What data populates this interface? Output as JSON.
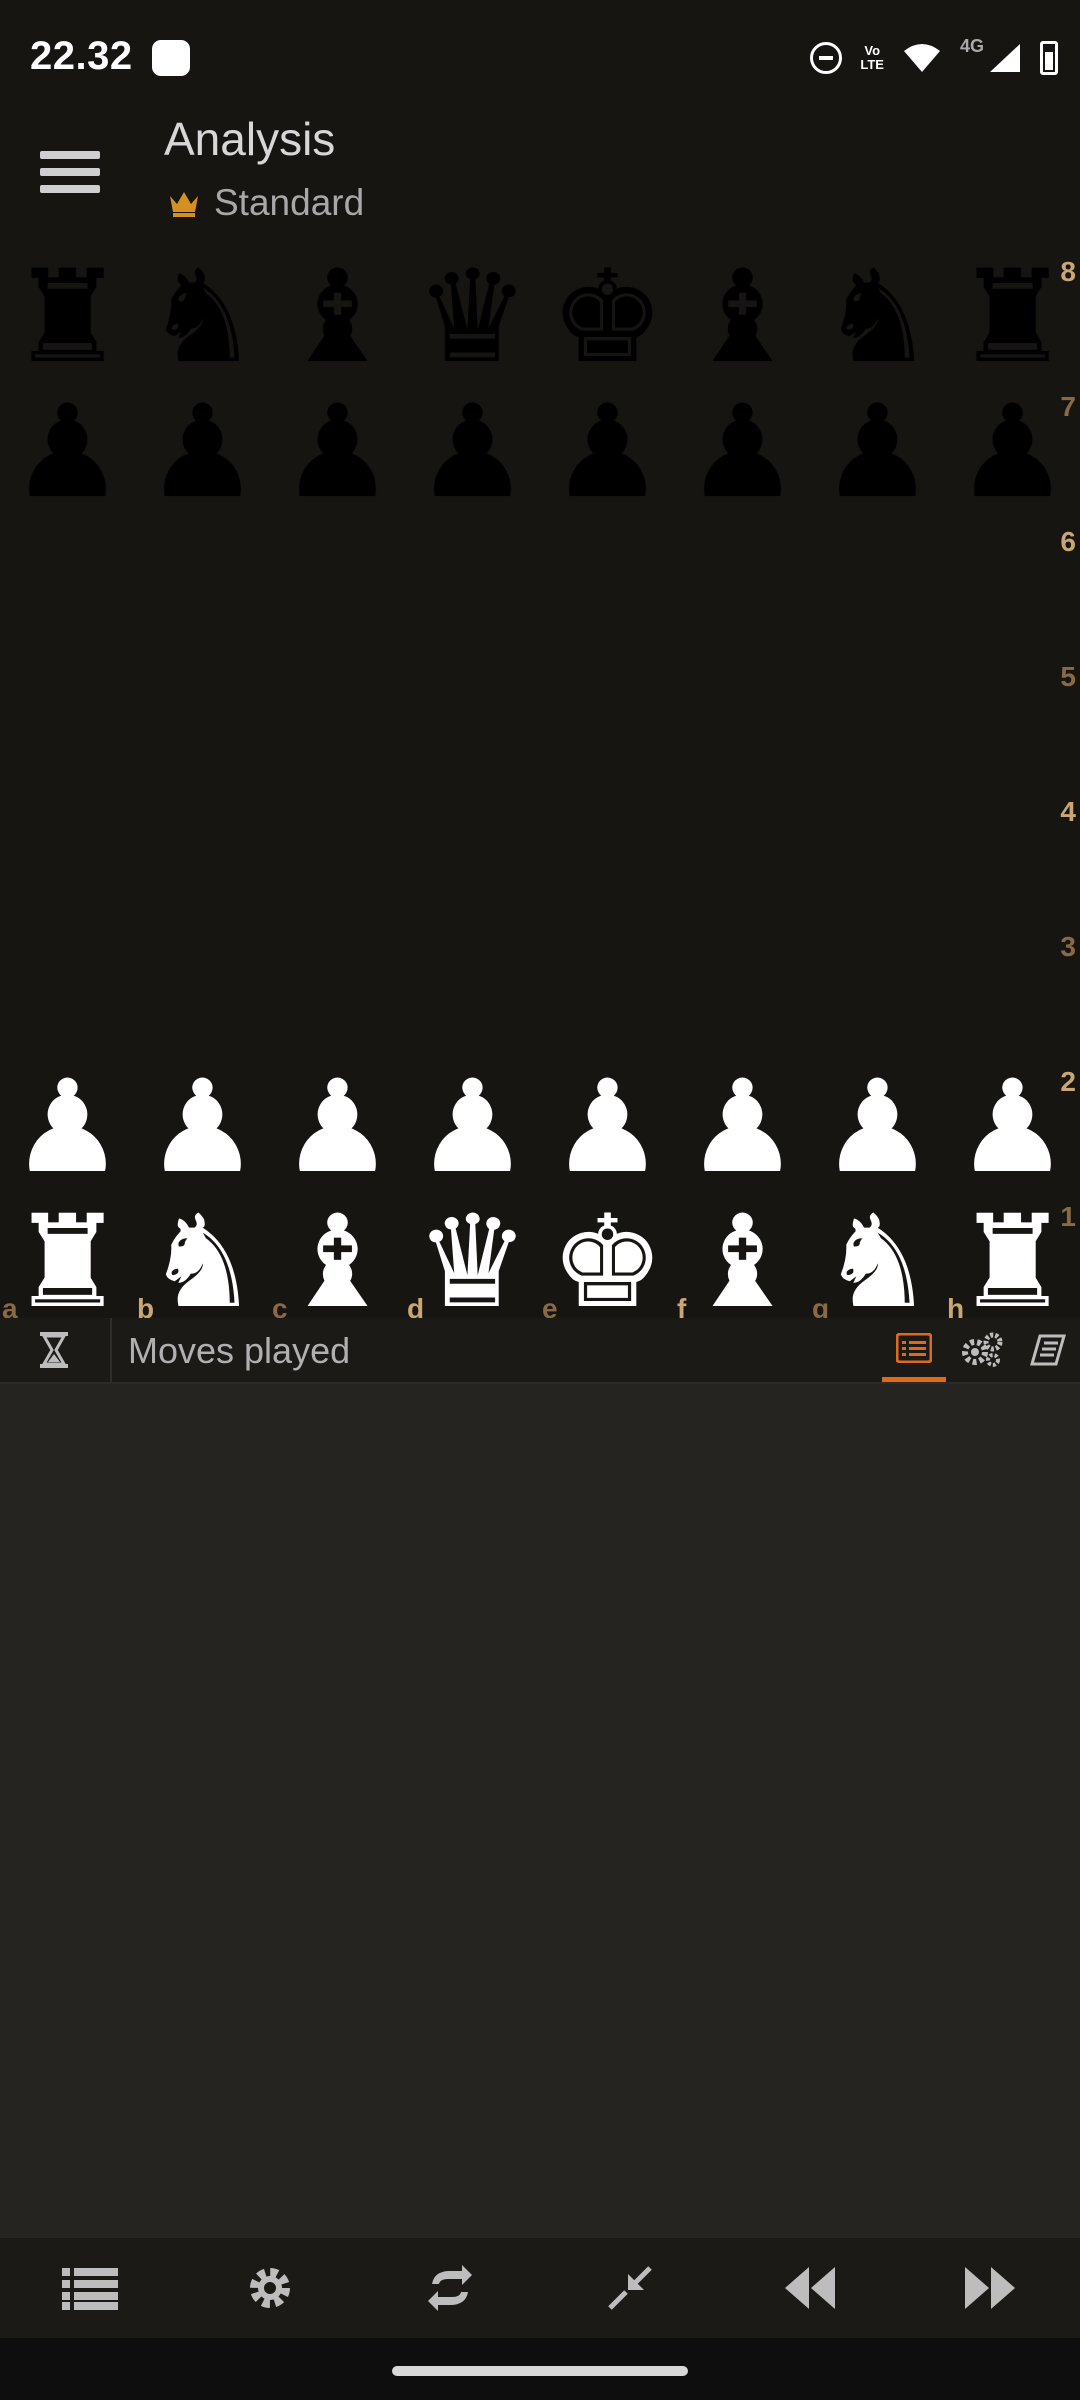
{
  "status_bar": {
    "time": "22.32",
    "volte_label_top": "Vo",
    "volte_label_bottom": "LTE",
    "network_label": "4G"
  },
  "app_bar": {
    "title": "Analysis",
    "variant": "Standard",
    "variant_icon": "crown-icon"
  },
  "board": {
    "ranks": [
      "8",
      "7",
      "6",
      "5",
      "4",
      "3",
      "2",
      "1"
    ],
    "files": [
      "a",
      "b",
      "c",
      "d",
      "e",
      "f",
      "g",
      "h"
    ],
    "position": [
      [
        "♜",
        "♞",
        "♝",
        "♛",
        "♚",
        "♝",
        "♞",
        "♜"
      ],
      [
        "♟",
        "♟",
        "♟",
        "♟",
        "♟",
        "♟",
        "♟",
        "♟"
      ],
      [
        "",
        "",
        "",
        "",
        "",
        "",
        "",
        ""
      ],
      [
        "",
        "",
        "",
        "",
        "",
        "",
        "",
        ""
      ],
      [
        "",
        "",
        "",
        "",
        "",
        "",
        "",
        ""
      ],
      [
        "",
        "",
        "",
        "",
        "",
        "",
        "",
        ""
      ],
      [
        "♟",
        "♟",
        "♟",
        "♟",
        "♟",
        "♟",
        "♟",
        "♟"
      ],
      [
        "♜",
        "♞",
        "♝",
        "♛",
        "♚",
        "♝",
        "♞",
        "♜"
      ]
    ],
    "colors": {
      "label_light": "#c9a673",
      "label_dark": "#8a6a45"
    }
  },
  "moves_bar": {
    "label": "Moves played",
    "tabs": [
      "moves-list-icon",
      "engine-settings-icon",
      "opening-book-icon"
    ],
    "active_tab": 0,
    "accent": "#e06a1c"
  },
  "bottom_nav": {
    "buttons": [
      "menu-list-icon",
      "settings-icon",
      "flip-board-icon",
      "collapse-icon",
      "previous-move-icon",
      "next-move-icon"
    ]
  }
}
